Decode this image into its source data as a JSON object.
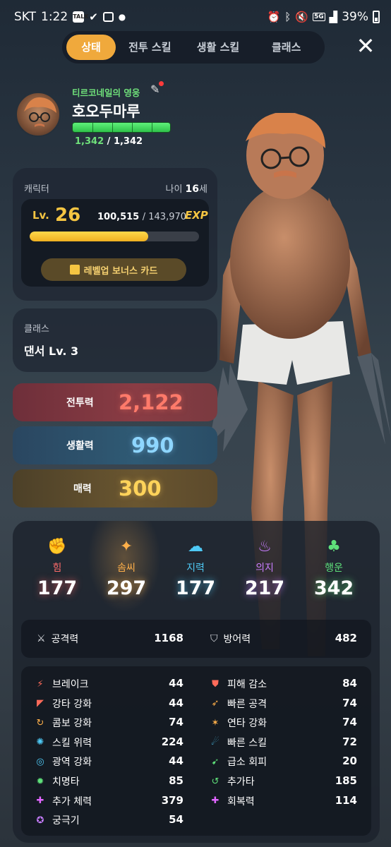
{
  "status_bar": {
    "carrier": "SKT",
    "time": "1:22",
    "talk_badge": "TALK",
    "network": "5G",
    "battery": "39%"
  },
  "tabs": [
    {
      "label": "상태",
      "active": true
    },
    {
      "label": "전투 스킬",
      "active": false
    },
    {
      "label": "생활 스킬",
      "active": false
    },
    {
      "label": "클래스",
      "active": false
    }
  ],
  "profile": {
    "title": "티르코네일의 영웅",
    "name": "호오두마루",
    "hp_current": "1,342",
    "hp_max": "1,342",
    "hp_fraction": 1.0
  },
  "character": {
    "section_label": "캐릭터",
    "age_prefix": "나이",
    "age_value": "16",
    "age_suffix": "세",
    "level_label": "Lv.",
    "level": "26",
    "exp_current": "100,515",
    "exp_max": "143,970",
    "exp_fraction": 0.698,
    "exp_badge": "EXP",
    "bonus_button": "레벨업 보너스 카드"
  },
  "class_info": {
    "section_label": "클래스",
    "value": "댄서 Lv. 3"
  },
  "power": {
    "combat_label": "전투력",
    "combat_value": "2,122",
    "life_label": "생활력",
    "life_value": "990",
    "charm_label": "매력",
    "charm_value": "300"
  },
  "attributes": [
    {
      "name": "힘",
      "value": "177",
      "color": "#ff6b6b",
      "icon": "fist-icon"
    },
    {
      "name": "솜씨",
      "value": "297",
      "color": "#ffb04a",
      "icon": "sparkle-hand-icon"
    },
    {
      "name": "지력",
      "value": "177",
      "color": "#4ec9f5",
      "icon": "brain-icon"
    },
    {
      "name": "의지",
      "value": "217",
      "color": "#c77dff",
      "icon": "flame-icon"
    },
    {
      "name": "행운",
      "value": "342",
      "color": "#5fe07a",
      "icon": "clover-icon"
    }
  ],
  "attack_defense": {
    "attack_label": "공격력",
    "attack_value": "1168",
    "defense_label": "방어력",
    "defense_value": "482"
  },
  "substats_left": [
    {
      "label": "브레이크",
      "value": "44",
      "icon": "break-icon",
      "color": "#ff6b5a"
    },
    {
      "label": "강타 강화",
      "value": "44",
      "icon": "smash-icon",
      "color": "#ff6b5a"
    },
    {
      "label": "콤보 강화",
      "value": "74",
      "icon": "combo-icon",
      "color": "#ffb04a"
    },
    {
      "label": "스킬 위력",
      "value": "224",
      "icon": "skill-power-icon",
      "color": "#4ec9f5"
    },
    {
      "label": "광역 강화",
      "value": "44",
      "icon": "area-icon",
      "color": "#4ec9f5"
    },
    {
      "label": "치명타",
      "value": "85",
      "icon": "critical-icon",
      "color": "#5fe07a"
    },
    {
      "label": "추가 체력",
      "value": "379",
      "icon": "extra-hp-icon",
      "color": "#e066ff"
    },
    {
      "label": "궁극기",
      "value": "54",
      "icon": "ultimate-icon",
      "color": "#c77dff"
    }
  ],
  "substats_right": [
    {
      "label": "피해 감소",
      "value": "84",
      "icon": "damage-reduce-icon",
      "color": "#ff6b5a"
    },
    {
      "label": "빠른 공격",
      "value": "74",
      "icon": "fast-attack-icon",
      "color": "#ffb04a"
    },
    {
      "label": "연타 강화",
      "value": "74",
      "icon": "multi-hit-icon",
      "color": "#ffb04a"
    },
    {
      "label": "빠른 스킬",
      "value": "72",
      "icon": "fast-skill-icon",
      "color": "#4ec9f5"
    },
    {
      "label": "급소 회피",
      "value": "20",
      "icon": "evade-icon",
      "color": "#5fe07a"
    },
    {
      "label": "추가타",
      "value": "185",
      "icon": "extra-hit-icon",
      "color": "#5fe07a"
    },
    {
      "label": "회복력",
      "value": "114",
      "icon": "recovery-icon",
      "color": "#e066ff"
    }
  ]
}
